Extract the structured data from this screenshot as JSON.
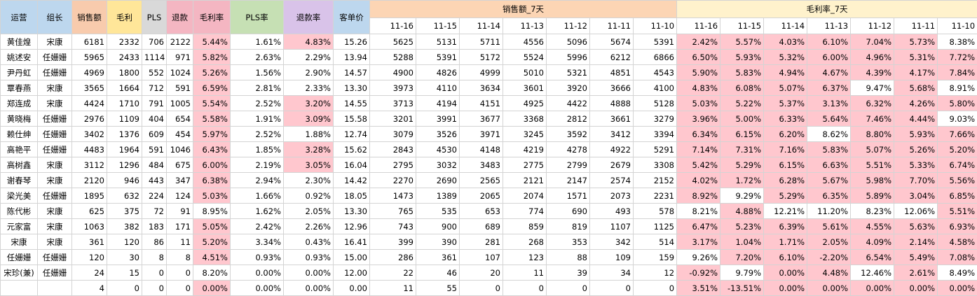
{
  "headers": {
    "ops": "运营",
    "leader": "组长",
    "sales": "销售额",
    "gross": "毛利",
    "pls": "PLS",
    "refund": "退款",
    "gross_rate": "毛利率",
    "pls_rate": "PLS率",
    "refund_rate": "退款率",
    "avg_price": "客单价",
    "sales_7d": "销售额_7天",
    "gross_rate_7d": "毛利率_7天"
  },
  "dates": [
    "11-16",
    "11-15",
    "11-14",
    "11-13",
    "11-12",
    "11-11",
    "11-10"
  ],
  "colors": {
    "highlight": "#ffc7ce",
    "header_blue": "#bdd7ee",
    "header_orange": "#f8cbad",
    "header_yellow": "#ffe699",
    "header_gray": "#d9d9d9",
    "header_pink": "#f4b6c2",
    "header_green": "#c6e0b4",
    "header_purple": "#d9c3e9",
    "header_peach": "#fcd5b4",
    "header_cream": "#fff2cc"
  },
  "rows": [
    {
      "ops": "黄佳煌",
      "leader": "宋康",
      "sales": "6181",
      "gross": "2332",
      "pls": "706",
      "refund": "2122",
      "gross_rate": "5.44%",
      "pls_rate": "1.61%",
      "refund_rate": "4.83%",
      "avg_price": "15.26",
      "gross_rate_hl": true,
      "refund_rate_hl": true,
      "sales_7d": [
        "5625",
        "5131",
        "5711",
        "4556",
        "5096",
        "5674",
        "5391"
      ],
      "gr_7d": [
        "2.42%",
        "5.57%",
        "4.03%",
        "6.10%",
        "7.04%",
        "5.73%",
        "8.38%"
      ],
      "gr_hl": [
        true,
        true,
        true,
        true,
        true,
        true,
        false
      ]
    },
    {
      "ops": "姚述安",
      "leader": "任姗姗",
      "sales": "5965",
      "gross": "2433",
      "pls": "1114",
      "refund": "971",
      "gross_rate": "5.82%",
      "pls_rate": "2.63%",
      "refund_rate": "2.29%",
      "avg_price": "13.94",
      "gross_rate_hl": true,
      "refund_rate_hl": false,
      "sales_7d": [
        "5288",
        "5391",
        "5172",
        "5524",
        "5996",
        "6212",
        "6866"
      ],
      "gr_7d": [
        "6.50%",
        "5.93%",
        "5.32%",
        "6.00%",
        "4.96%",
        "5.31%",
        "7.72%"
      ],
      "gr_hl": [
        true,
        true,
        true,
        true,
        true,
        true,
        true
      ]
    },
    {
      "ops": "尹丹虹",
      "leader": "任姗姗",
      "sales": "4969",
      "gross": "1800",
      "pls": "552",
      "refund": "1024",
      "gross_rate": "5.26%",
      "pls_rate": "1.56%",
      "refund_rate": "2.90%",
      "avg_price": "14.57",
      "gross_rate_hl": true,
      "refund_rate_hl": false,
      "sales_7d": [
        "4900",
        "4826",
        "4999",
        "5010",
        "5321",
        "4851",
        "4543"
      ],
      "gr_7d": [
        "5.90%",
        "5.83%",
        "4.94%",
        "4.67%",
        "4.39%",
        "4.17%",
        "7.84%"
      ],
      "gr_hl": [
        true,
        true,
        true,
        true,
        true,
        true,
        true
      ]
    },
    {
      "ops": "覃春燕",
      "leader": "宋康",
      "sales": "3565",
      "gross": "1664",
      "pls": "712",
      "refund": "591",
      "gross_rate": "6.59%",
      "pls_rate": "2.81%",
      "refund_rate": "2.33%",
      "avg_price": "13.30",
      "gross_rate_hl": true,
      "refund_rate_hl": false,
      "sales_7d": [
        "3973",
        "4110",
        "3634",
        "3601",
        "3920",
        "3666",
        "4100"
      ],
      "gr_7d": [
        "4.83%",
        "6.08%",
        "5.07%",
        "6.37%",
        "9.47%",
        "5.68%",
        "8.91%"
      ],
      "gr_hl": [
        true,
        true,
        true,
        true,
        false,
        true,
        false
      ]
    },
    {
      "ops": "郑连成",
      "leader": "宋康",
      "sales": "4424",
      "gross": "1710",
      "pls": "791",
      "refund": "1005",
      "gross_rate": "5.54%",
      "pls_rate": "2.52%",
      "refund_rate": "3.20%",
      "avg_price": "14.55",
      "gross_rate_hl": true,
      "refund_rate_hl": true,
      "sales_7d": [
        "3713",
        "4194",
        "4151",
        "4925",
        "4422",
        "4888",
        "5128"
      ],
      "gr_7d": [
        "5.03%",
        "5.22%",
        "5.37%",
        "3.13%",
        "6.32%",
        "4.26%",
        "5.80%"
      ],
      "gr_hl": [
        true,
        true,
        true,
        true,
        true,
        true,
        true
      ]
    },
    {
      "ops": "黄晓梅",
      "leader": "任姗姗",
      "sales": "2976",
      "gross": "1109",
      "pls": "404",
      "refund": "654",
      "gross_rate": "5.58%",
      "pls_rate": "1.91%",
      "refund_rate": "3.09%",
      "avg_price": "15.58",
      "gross_rate_hl": true,
      "refund_rate_hl": true,
      "sales_7d": [
        "3201",
        "3991",
        "3677",
        "3368",
        "2812",
        "3661",
        "3279"
      ],
      "gr_7d": [
        "3.96%",
        "5.00%",
        "6.33%",
        "5.64%",
        "7.46%",
        "4.44%",
        "9.03%"
      ],
      "gr_hl": [
        true,
        true,
        true,
        true,
        true,
        true,
        false
      ]
    },
    {
      "ops": "赖仕绅",
      "leader": "任姗姗",
      "sales": "3402",
      "gross": "1376",
      "pls": "609",
      "refund": "454",
      "gross_rate": "5.97%",
      "pls_rate": "2.52%",
      "refund_rate": "1.88%",
      "avg_price": "12.74",
      "gross_rate_hl": true,
      "refund_rate_hl": false,
      "sales_7d": [
        "3079",
        "3526",
        "3971",
        "3245",
        "3592",
        "3412",
        "3394"
      ],
      "gr_7d": [
        "6.34%",
        "6.15%",
        "6.20%",
        "8.62%",
        "8.80%",
        "5.93%",
        "7.66%"
      ],
      "gr_hl": [
        true,
        true,
        true,
        false,
        true,
        true,
        true
      ]
    },
    {
      "ops": "高艳平",
      "leader": "任姗姗",
      "sales": "4483",
      "gross": "1964",
      "pls": "591",
      "refund": "1046",
      "gross_rate": "6.43%",
      "pls_rate": "1.85%",
      "refund_rate": "3.28%",
      "avg_price": "15.62",
      "gross_rate_hl": true,
      "refund_rate_hl": true,
      "sales_7d": [
        "2843",
        "4530",
        "4148",
        "4219",
        "4278",
        "4922",
        "5291"
      ],
      "gr_7d": [
        "7.14%",
        "7.31%",
        "7.16%",
        "5.83%",
        "5.07%",
        "5.26%",
        "5.20%"
      ],
      "gr_hl": [
        true,
        true,
        true,
        true,
        true,
        true,
        true
      ]
    },
    {
      "ops": "高树鑫",
      "leader": "宋康",
      "sales": "3112",
      "gross": "1296",
      "pls": "484",
      "refund": "675",
      "gross_rate": "6.00%",
      "pls_rate": "2.19%",
      "refund_rate": "3.05%",
      "avg_price": "16.04",
      "gross_rate_hl": true,
      "refund_rate_hl": true,
      "sales_7d": [
        "2795",
        "3032",
        "3483",
        "2775",
        "2799",
        "2679",
        "3308"
      ],
      "gr_7d": [
        "5.42%",
        "5.29%",
        "6.15%",
        "6.63%",
        "5.51%",
        "5.33%",
        "6.74%"
      ],
      "gr_hl": [
        true,
        true,
        true,
        true,
        true,
        true,
        true
      ]
    },
    {
      "ops": "谢春琴",
      "leader": "宋康",
      "sales": "2120",
      "gross": "946",
      "pls": "443",
      "refund": "347",
      "gross_rate": "6.38%",
      "pls_rate": "2.94%",
      "refund_rate": "2.30%",
      "avg_price": "14.42",
      "gross_rate_hl": true,
      "refund_rate_hl": false,
      "sales_7d": [
        "2270",
        "2690",
        "2565",
        "2121",
        "2147",
        "2574",
        "2152"
      ],
      "gr_7d": [
        "4.02%",
        "1.72%",
        "6.28%",
        "5.67%",
        "5.98%",
        "7.70%",
        "5.56%"
      ],
      "gr_hl": [
        true,
        true,
        true,
        true,
        true,
        true,
        true
      ]
    },
    {
      "ops": "梁光美",
      "leader": "任姗姗",
      "sales": "1895",
      "gross": "632",
      "pls": "224",
      "refund": "124",
      "gross_rate": "5.03%",
      "pls_rate": "1.66%",
      "refund_rate": "0.92%",
      "avg_price": "18.05",
      "gross_rate_hl": true,
      "refund_rate_hl": false,
      "sales_7d": [
        "1473",
        "1389",
        "2065",
        "2074",
        "1571",
        "2073",
        "2231"
      ],
      "gr_7d": [
        "8.92%",
        "9.29%",
        "5.29%",
        "6.35%",
        "5.89%",
        "3.04%",
        "6.85%"
      ],
      "gr_hl": [
        true,
        false,
        true,
        true,
        true,
        true,
        true
      ]
    },
    {
      "ops": "陈代彬",
      "leader": "宋康",
      "sales": "625",
      "gross": "375",
      "pls": "72",
      "refund": "91",
      "gross_rate": "8.95%",
      "pls_rate": "1.62%",
      "refund_rate": "2.05%",
      "avg_price": "13.30",
      "gross_rate_hl": false,
      "refund_rate_hl": false,
      "sales_7d": [
        "765",
        "535",
        "653",
        "774",
        "690",
        "493",
        "578"
      ],
      "gr_7d": [
        "8.21%",
        "4.88%",
        "12.21%",
        "11.20%",
        "8.23%",
        "12.06%",
        "5.51%"
      ],
      "gr_hl": [
        false,
        true,
        false,
        false,
        false,
        false,
        true
      ]
    },
    {
      "ops": "元家富",
      "leader": "宋康",
      "sales": "1063",
      "gross": "382",
      "pls": "183",
      "refund": "171",
      "gross_rate": "5.05%",
      "pls_rate": "2.42%",
      "refund_rate": "2.26%",
      "avg_price": "12.96",
      "gross_rate_hl": true,
      "refund_rate_hl": false,
      "sales_7d": [
        "743",
        "900",
        "689",
        "859",
        "819",
        "1107",
        "1125"
      ],
      "gr_7d": [
        "6.47%",
        "5.23%",
        "6.39%",
        "5.61%",
        "4.55%",
        "5.63%",
        "6.93%"
      ],
      "gr_hl": [
        true,
        true,
        true,
        true,
        true,
        true,
        true
      ]
    },
    {
      "ops": "宋康",
      "leader": "宋康",
      "sales": "361",
      "gross": "120",
      "pls": "86",
      "refund": "11",
      "gross_rate": "5.20%",
      "pls_rate": "3.34%",
      "refund_rate": "0.43%",
      "avg_price": "16.41",
      "gross_rate_hl": true,
      "refund_rate_hl": false,
      "sales_7d": [
        "399",
        "390",
        "281",
        "268",
        "353",
        "342",
        "514"
      ],
      "gr_7d": [
        "3.17%",
        "1.04%",
        "1.71%",
        "2.05%",
        "4.09%",
        "2.14%",
        "4.58%"
      ],
      "gr_hl": [
        true,
        true,
        true,
        true,
        true,
        true,
        true
      ]
    },
    {
      "ops": "任姗姗",
      "leader": "任姗姗",
      "sales": "120",
      "gross": "30",
      "pls": "8",
      "refund": "8",
      "gross_rate": "4.51%",
      "pls_rate": "0.93%",
      "refund_rate": "0.93%",
      "avg_price": "15.00",
      "gross_rate_hl": true,
      "refund_rate_hl": false,
      "sales_7d": [
        "286",
        "361",
        "107",
        "123",
        "88",
        "109",
        "159"
      ],
      "gr_7d": [
        "9.26%",
        "7.20%",
        "6.10%",
        "-2.20%",
        "6.54%",
        "5.49%",
        "7.08%"
      ],
      "gr_hl": [
        false,
        true,
        true,
        true,
        true,
        true,
        true
      ]
    },
    {
      "ops": "宋珍(兼)",
      "leader": "任姗姗",
      "sales": "24",
      "gross": "15",
      "pls": "0",
      "refund": "0",
      "gross_rate": "8.20%",
      "pls_rate": "0.00%",
      "refund_rate": "0.00%",
      "avg_price": "12.00",
      "gross_rate_hl": false,
      "refund_rate_hl": false,
      "sales_7d": [
        "22",
        "46",
        "20",
        "11",
        "39",
        "34",
        "12"
      ],
      "gr_7d": [
        "-0.92%",
        "9.79%",
        "0.00%",
        "4.48%",
        "12.46%",
        "2.61%",
        "8.49%"
      ],
      "gr_hl": [
        true,
        false,
        true,
        true,
        false,
        true,
        false
      ]
    },
    {
      "ops": "",
      "leader": "",
      "sales": "4",
      "gross": "0",
      "pls": "0",
      "refund": "0",
      "gross_rate": "0.00%",
      "pls_rate": "0.00%",
      "refund_rate": "0.00%",
      "avg_price": "0.00",
      "gross_rate_hl": true,
      "refund_rate_hl": false,
      "sales_7d": [
        "11",
        "55",
        "0",
        "0",
        "0",
        "0",
        "0"
      ],
      "gr_7d": [
        "3.51%",
        "-13.51%",
        "0.00%",
        "0.00%",
        "0.00%",
        "0.00%",
        "0.00%"
      ],
      "gr_hl": [
        true,
        true,
        true,
        true,
        true,
        true,
        true
      ]
    }
  ]
}
